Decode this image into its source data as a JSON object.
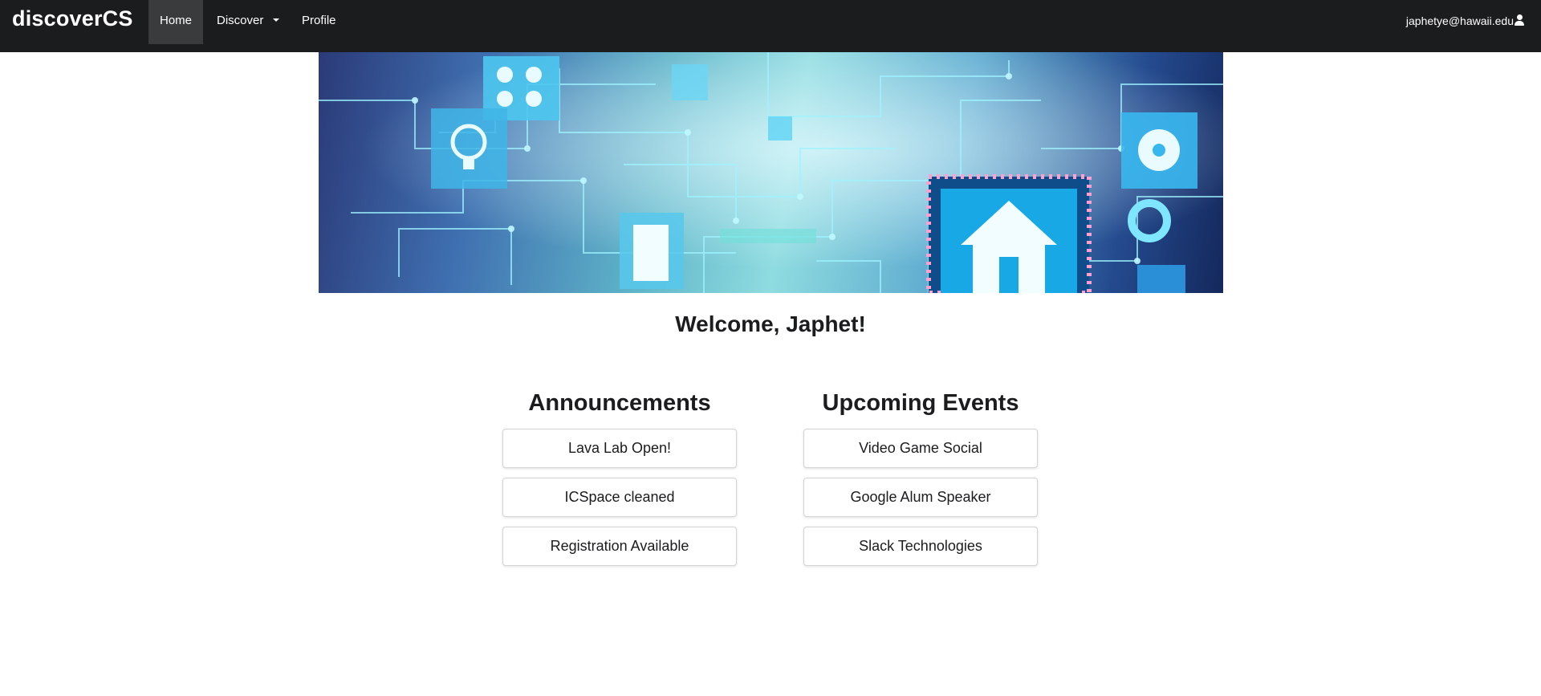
{
  "navbar": {
    "brand": "discoverCS",
    "items": [
      {
        "label": "Home"
      },
      {
        "label": "Discover"
      },
      {
        "label": "Profile"
      }
    ],
    "user_email": "japhetye@hawaii.edu",
    "background_color": "#1b1c1d",
    "active_item_color": "#3a3b3c"
  },
  "welcome": "Welcome, Japhet!",
  "announcements": {
    "title": "Announcements",
    "items": [
      {
        "label": "Lava Lab Open!"
      },
      {
        "label": "ICSpace cleaned"
      },
      {
        "label": "Registration Available"
      }
    ]
  },
  "events": {
    "title": "Upcoming Events",
    "items": [
      {
        "label": "Video Game Social"
      },
      {
        "label": "Google Alum Speaker"
      },
      {
        "label": "Slack Technologies"
      }
    ]
  }
}
